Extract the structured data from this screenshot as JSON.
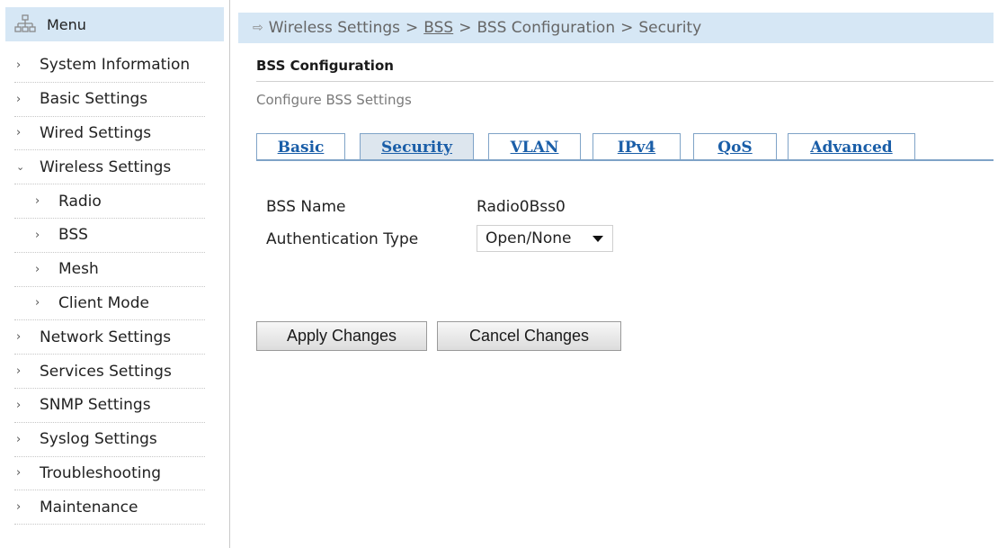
{
  "sidebar": {
    "header": {
      "label": "Menu",
      "icon": "sitemap-icon"
    },
    "items": [
      {
        "label": "System Information",
        "chevron": "›"
      },
      {
        "label": "Basic Settings",
        "chevron": "›"
      },
      {
        "label": "Wired Settings",
        "chevron": "›"
      },
      {
        "label": "Wireless Settings",
        "chevron": "⌄"
      },
      {
        "label": "Radio",
        "chevron": "›"
      },
      {
        "label": "BSS",
        "chevron": "›"
      },
      {
        "label": "Mesh",
        "chevron": "›"
      },
      {
        "label": "Client Mode",
        "chevron": "›"
      },
      {
        "label": "Network Settings",
        "chevron": "›"
      },
      {
        "label": "Services Settings",
        "chevron": "›"
      },
      {
        "label": "SNMP Settings",
        "chevron": "›"
      },
      {
        "label": "Syslog Settings",
        "chevron": "›"
      },
      {
        "label": "Troubleshooting",
        "chevron": "›"
      },
      {
        "label": "Maintenance",
        "chevron": "›"
      }
    ]
  },
  "breadcrumb": {
    "arrow": "⇨",
    "separator": ">",
    "items": [
      "Wireless Settings",
      "BSS",
      "BSS Configuration",
      "Security"
    ]
  },
  "page": {
    "title": "BSS Configuration",
    "subtitle": "Configure BSS Settings"
  },
  "tabs": [
    {
      "label": "Basic",
      "active": false
    },
    {
      "label": "Security",
      "active": true
    },
    {
      "label": "VLAN",
      "active": false
    },
    {
      "label": "IPv4",
      "active": false
    },
    {
      "label": "QoS",
      "active": false
    },
    {
      "label": "Advanced",
      "active": false
    }
  ],
  "form": {
    "bss_name_label": "BSS Name",
    "bss_name_value": "Radio0Bss0",
    "auth_type_label": "Authentication Type",
    "auth_type_value": "Open/None"
  },
  "buttons": {
    "apply": "Apply Changes",
    "cancel": "Cancel Changes"
  },
  "colors": {
    "header_bg": "#d6e7f5",
    "tab_link": "#1a5ea8",
    "tab_border": "#7fa3c7",
    "active_tab_bg": "#dde6ee"
  }
}
